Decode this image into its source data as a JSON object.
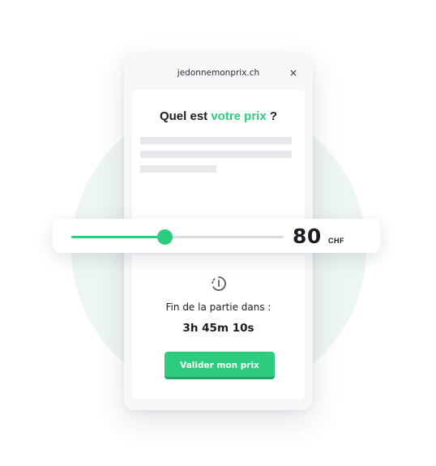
{
  "header": {
    "domain": "jedonnemonprix.ch",
    "close_label": "×"
  },
  "question": {
    "prefix": "Quel est ",
    "highlight": "votre prix",
    "suffix": " ?"
  },
  "slider": {
    "value": 80,
    "amount_text": "80",
    "currency": "CHF",
    "fill_fraction": 0.44
  },
  "timer": {
    "label": "Fin de la partie dans :",
    "remaining": "3h 45m 10s",
    "icon": "timer-icon"
  },
  "actions": {
    "submit_label": "Valider mon prix"
  },
  "colors": {
    "accent": "#2ecc7f",
    "background_circle": "#eef6f2",
    "text": "#1b1d22"
  }
}
